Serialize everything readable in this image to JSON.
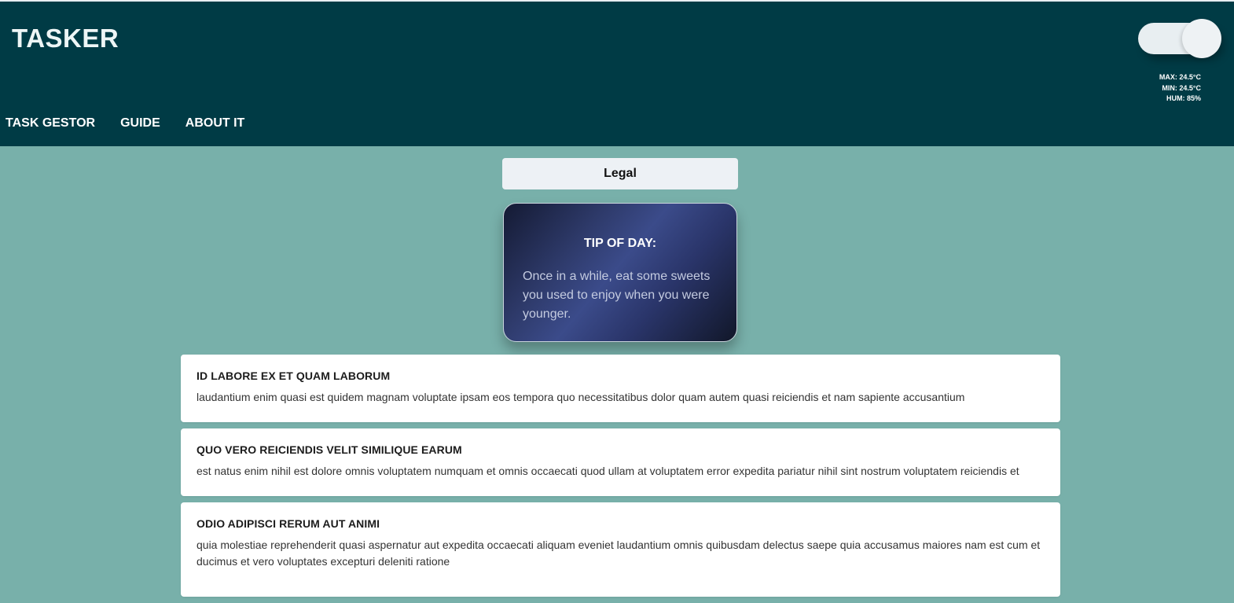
{
  "header": {
    "brand": "TASKER",
    "weather": {
      "max": "MAX: 24.5°C",
      "min": "MIN: 24.5°C",
      "hum": "HUM: 85%"
    },
    "nav": [
      "TASK GESTOR",
      "GUIDE",
      "ABOUT IT"
    ]
  },
  "category_button": "Legal",
  "tip": {
    "title": "TIP OF DAY:",
    "text": "Once in a while, eat some sweets you used to enjoy when you were younger."
  },
  "posts": [
    {
      "title": "ID LABORE EX ET QUAM LABORUM",
      "body": "laudantium enim quasi est quidem magnam voluptate ipsam eos tempora quo necessitatibus dolor quam autem quasi reiciendis et nam sapiente accusantium"
    },
    {
      "title": "QUO VERO REICIENDIS VELIT SIMILIQUE EARUM",
      "body": "est natus enim nihil est dolore omnis voluptatem numquam et omnis occaecati quod ullam at voluptatem error expedita pariatur nihil sint nostrum voluptatem reiciendis et"
    },
    {
      "title": "ODIO ADIPISCI RERUM AUT ANIMI",
      "body": "quia molestiae reprehenderit quasi aspernatur aut expedita occaecati aliquam eveniet laudantium omnis quibusdam delectus saepe quia accusamus maiores nam est cum et ducimus et vero voluptates excepturi deleniti ratione"
    }
  ]
}
